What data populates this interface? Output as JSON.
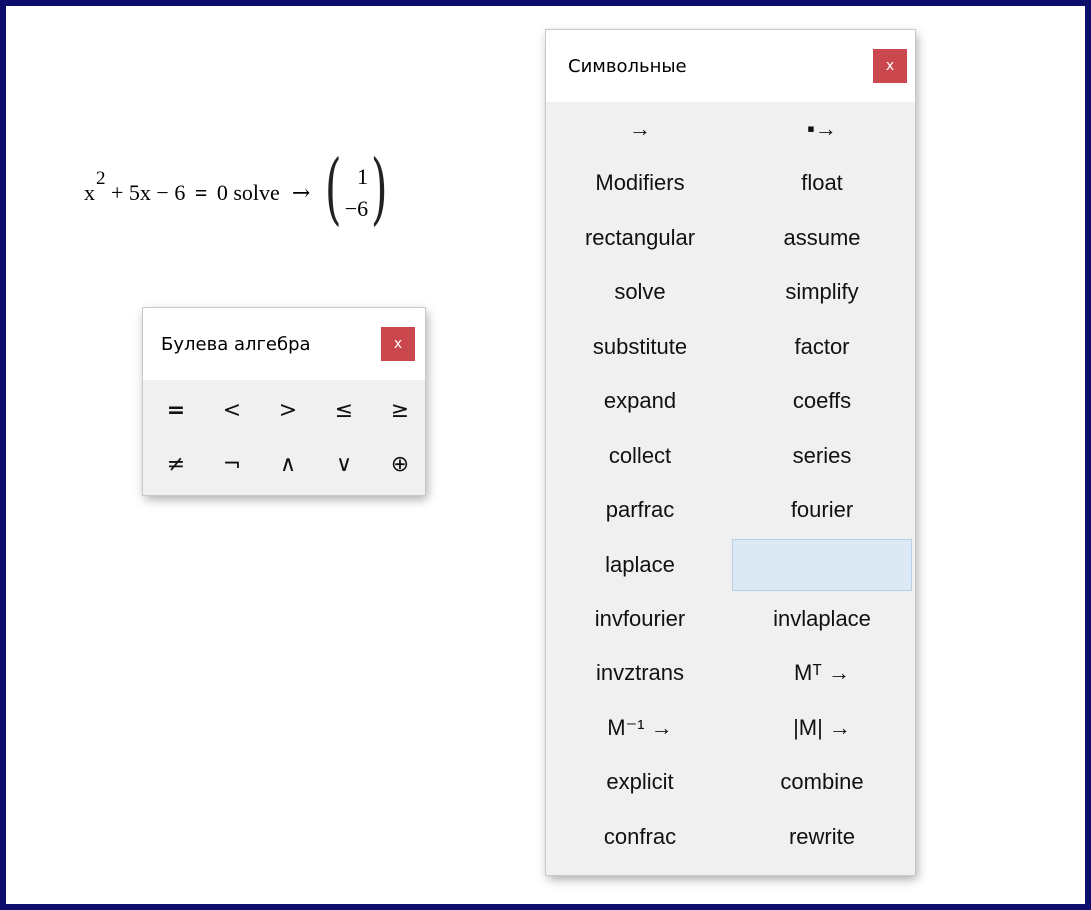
{
  "equation": {
    "base": "x",
    "exponent": "2",
    "rest": " + 5x − 6 ",
    "equals": "=",
    "rhs": " 0 solve",
    "arrow": "→",
    "result": [
      "1",
      "−6"
    ]
  },
  "bool_panel": {
    "title": "Булева алгебра",
    "close": "x",
    "operators": [
      "=",
      "<",
      ">",
      "≤",
      "≥",
      "≠",
      "¬",
      "∧",
      "∨",
      "⊕"
    ]
  },
  "sym_panel": {
    "title": "Символьные",
    "close": "x",
    "buttons": [
      "→",
      "▪→",
      "Modifiers",
      "float",
      "rectangular",
      "assume",
      "solve",
      "simplify",
      "substitute",
      "factor",
      "expand",
      "coeffs",
      "collect",
      "series",
      "parfrac",
      "fourier",
      "laplace",
      "",
      "invfourier",
      "invlaplace",
      "invztrans",
      "Mᵀ →",
      "M⁻¹ →",
      "|M| →",
      "explicit",
      "combine",
      "confrac",
      "rewrite"
    ],
    "highlighted_index": 17
  }
}
